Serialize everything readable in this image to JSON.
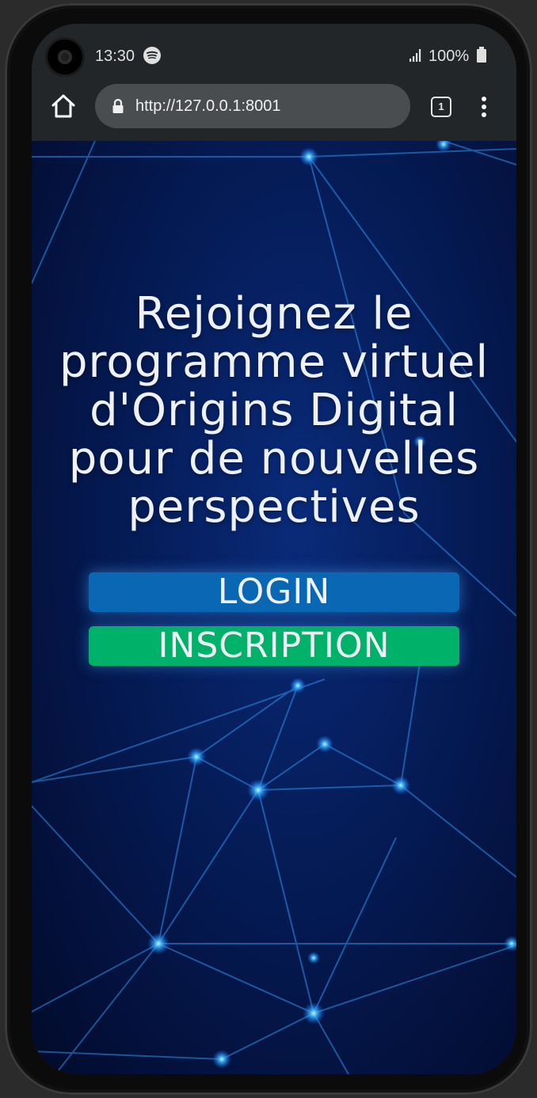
{
  "status_bar": {
    "time": "13:30",
    "battery": "100%",
    "icons": [
      "spotify-icon",
      "signal-icon",
      "battery-icon"
    ]
  },
  "browser": {
    "url": "http://127.0.0.1:8001",
    "tab_count": "1",
    "icons": [
      "home-icon",
      "lock-icon",
      "tabs-icon",
      "menu-icon"
    ]
  },
  "page": {
    "headline_lines": [
      "Rejoignez le",
      "programme virtuel",
      "d'Origins Digital",
      "pour de nouvelles",
      "perspectives"
    ],
    "login_label": "LOGIN",
    "signup_label": "INSCRIPTION"
  },
  "colors": {
    "login_button": "#0a67b4",
    "signup_button": "#00b16a",
    "background": "#051d5a",
    "browser_chrome": "#222629"
  }
}
